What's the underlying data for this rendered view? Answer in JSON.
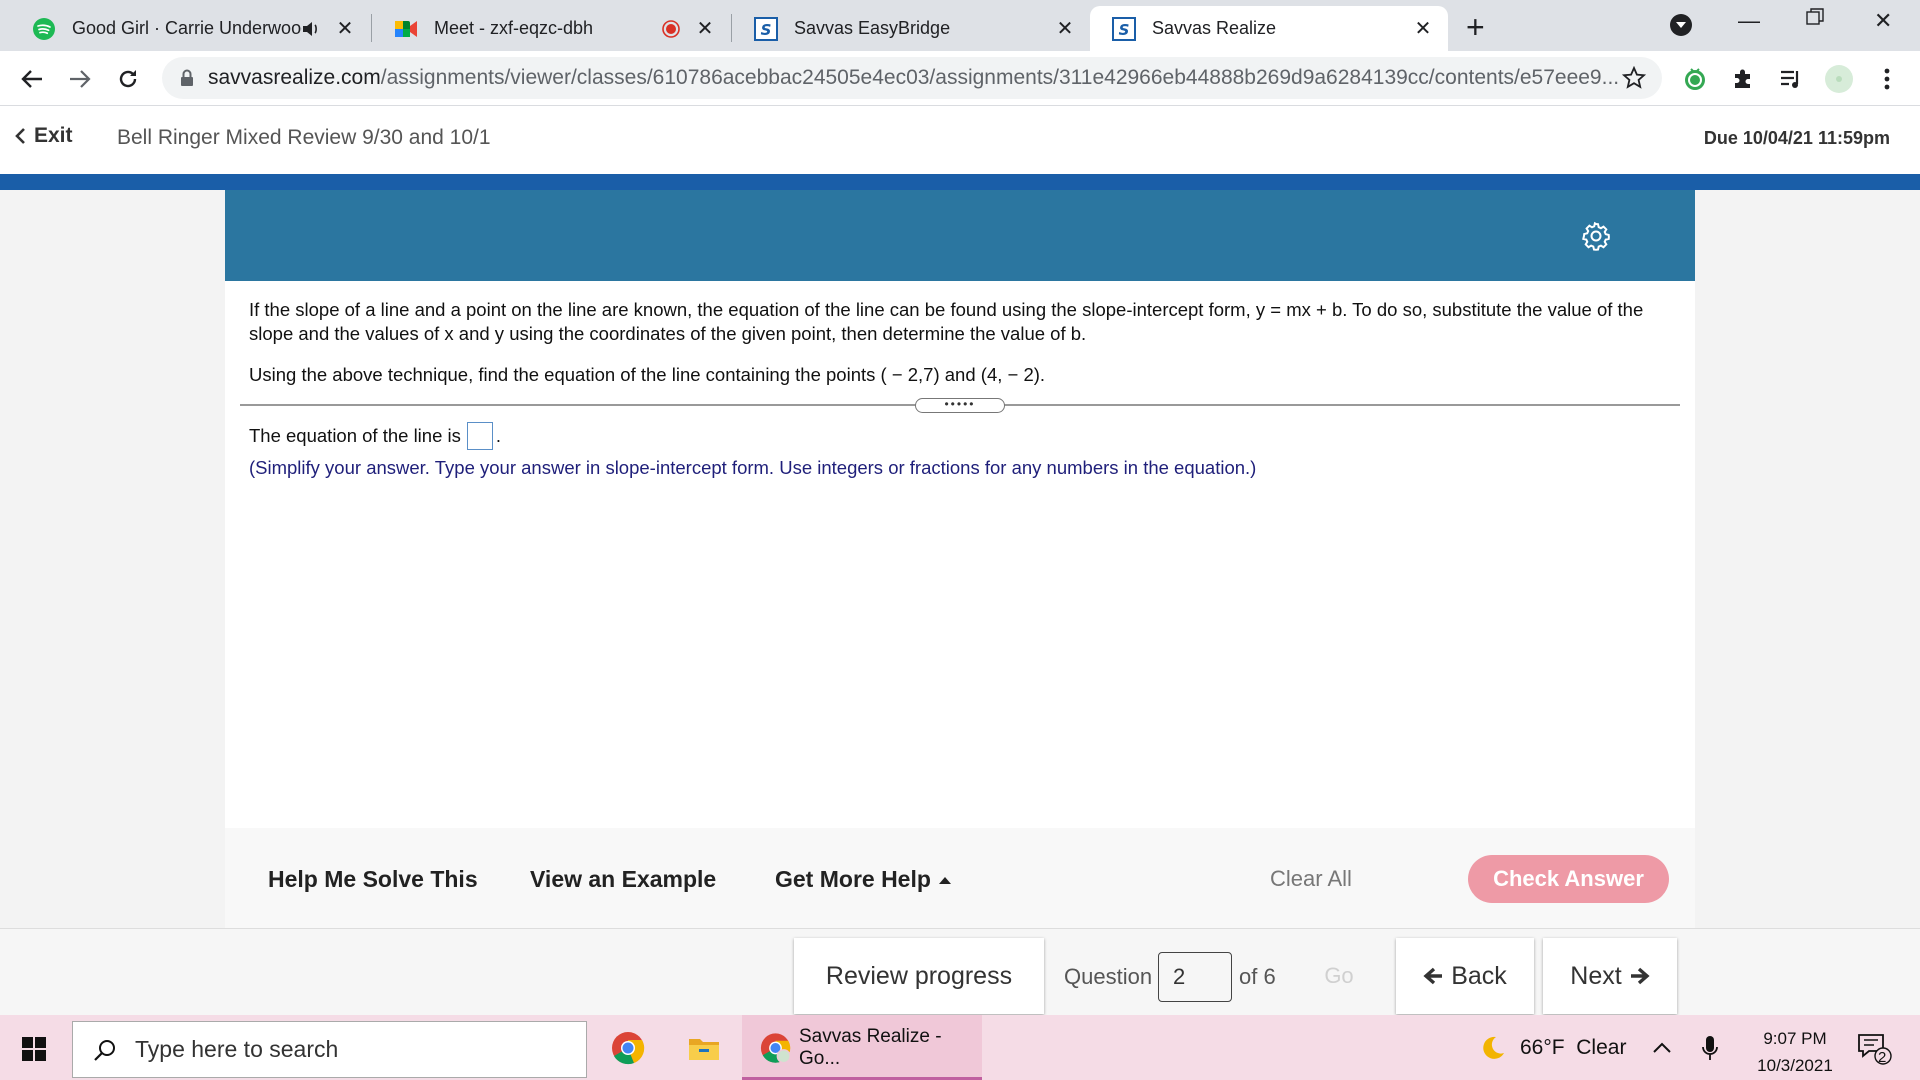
{
  "browser": {
    "tabs": [
      {
        "title": "Good Girl · Carrie Underwood",
        "favicon": "spotify-icon",
        "audio": true
      },
      {
        "title": "Meet - zxf-eqzc-dbh",
        "favicon": "google-meet-icon",
        "recording": true
      },
      {
        "title": "Savvas EasyBridge",
        "favicon": "savvas-icon"
      },
      {
        "title": "Savvas Realize",
        "favicon": "savvas-icon",
        "active": true
      }
    ],
    "url_host": "savvasrealize.com",
    "url_path": "/assignments/viewer/classes/610786acebbac24505e4ec03/assignments/311e42966eb44888b269d9a6284139cc/contents/e57eee9..."
  },
  "assignment": {
    "exit_label": "Exit",
    "title": "Bell Ringer Mixed Review 9/30 and 10/1",
    "due": "Due 10/04/21 11:59pm"
  },
  "question": {
    "intro": "If the slope of a line and a point on the line are known, the equation of the line can be found using the slope-intercept form, y = mx + b. To do so, substitute the value of the slope and the values of x and y using the coordinates of the given point, then determine the value of b.",
    "prompt": "Using the above technique, find the equation of the line containing the points ( − 2,7) and (4, − 2).",
    "answer_label": "The equation of the line is",
    "answer_value": "",
    "hint": "(Simplify your answer. Type your answer in slope-intercept form. Use integers or fractions for any numbers in the equation.)",
    "grip_dots": "•••••"
  },
  "help": {
    "help_me_solve": "Help Me Solve This",
    "view_example": "View an Example",
    "get_more_help": "Get More Help",
    "clear_all": "Clear All",
    "check_answer": "Check Answer"
  },
  "nav": {
    "review_progress": "Review progress",
    "question_label": "Question",
    "question_number": "2",
    "of_total": "of 6",
    "go": "Go",
    "back": "Back",
    "next": "Next"
  },
  "taskbar": {
    "search_placeholder": "Type here to search",
    "active_app": "Savvas Realize - Go...",
    "weather": "66°F  Clear",
    "time": "9:07 PM",
    "date": "10/3/2021",
    "notifications": "2"
  },
  "colors": {
    "header_blue": "#2b76a0",
    "accent_bar": "#1a5ea8",
    "check_answer": "#ee9aa6",
    "hint_text": "#1f1f7a"
  }
}
